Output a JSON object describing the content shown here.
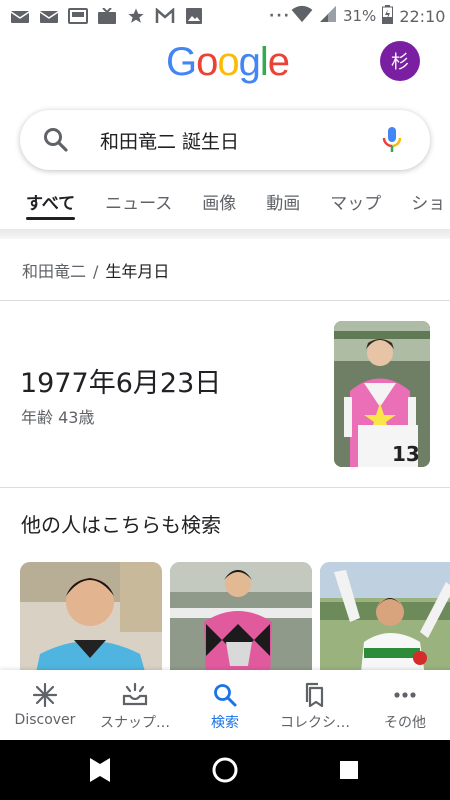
{
  "status_bar": {
    "time": "22:10",
    "battery": "31%",
    "icons": [
      "mail-icon",
      "mail-icon",
      "wallet-icon",
      "tv-icon",
      "star-icon",
      "gmail-icon",
      "image-icon",
      "more-dots-icon",
      "wifi-icon",
      "signal-icon",
      "battery-icon"
    ]
  },
  "header": {
    "logo_letters": [
      "G",
      "o",
      "o",
      "g",
      "l",
      "e"
    ],
    "logo_colors": [
      "#4285F4",
      "#EA4335",
      "#FBBC05",
      "#4285F4",
      "#34A853",
      "#EA4335"
    ],
    "avatar_initial": "杉",
    "avatar_color": "#7b1fa2"
  },
  "search": {
    "query": "和田竜二 誕生日"
  },
  "tabs": [
    {
      "label": "すべて",
      "active": true
    },
    {
      "label": "ニュース"
    },
    {
      "label": "画像"
    },
    {
      "label": "動画"
    },
    {
      "label": "マップ"
    },
    {
      "label": "ショ"
    }
  ],
  "breadcrumb": {
    "parent": "和田竜二",
    "separator": "/",
    "current": "生年月日"
  },
  "answer": {
    "date": "1977年6月23日",
    "age": "年齢 43歳"
  },
  "related": {
    "title": "他の人はこちらも検索",
    "cards": [
      {
        "image": "jockey-portrait-blue"
      },
      {
        "image": "jockey-pink-black-silks"
      },
      {
        "image": "jockey-celebrating"
      }
    ]
  },
  "bottom_nav": [
    {
      "label": "Discover",
      "icon": "discover-asterisk-icon"
    },
    {
      "label": "スナップ…",
      "icon": "snap-tray-icon"
    },
    {
      "label": "検索",
      "icon": "search-icon",
      "active": true
    },
    {
      "label": "コレクシ…",
      "icon": "bookmarks-icon"
    },
    {
      "label": "その他",
      "icon": "more-horiz-icon"
    }
  ],
  "colors": {
    "accent": "#1a73e8",
    "text": "#202124",
    "secondary": "#5f6368"
  }
}
